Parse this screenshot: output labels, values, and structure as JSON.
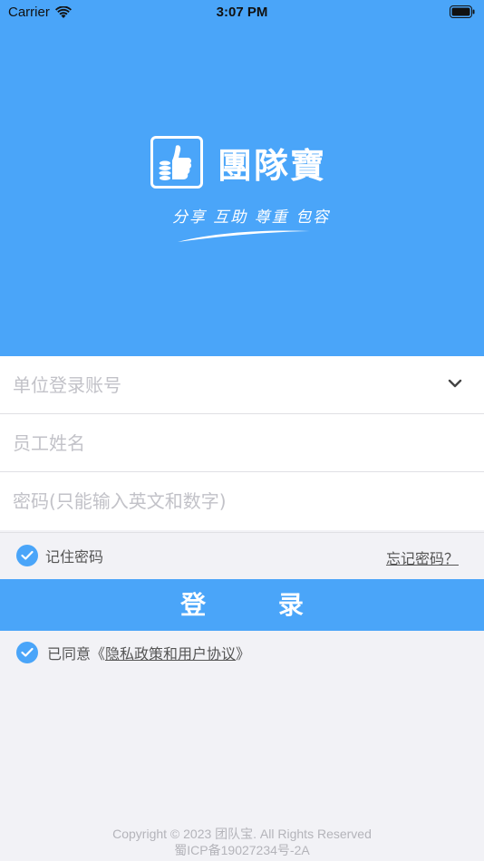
{
  "status_bar": {
    "carrier": "Carrier",
    "time": "3:07 PM"
  },
  "brand": {
    "name": "團隊寶",
    "slogan": "分享 互助 尊重 包容",
    "color": "#4aa5f9"
  },
  "form": {
    "account_placeholder": "单位登录账号",
    "name_placeholder": "员工姓名",
    "password_placeholder": "密码(只能输入英文和数字)"
  },
  "options": {
    "remember_label": "记住密码",
    "remember_checked": true,
    "forgot_label": "忘记密码？"
  },
  "login_label": "登 录",
  "agreement": {
    "checked": true,
    "prefix": "已同意",
    "open": "《",
    "link": "隐私政策和用户协议",
    "close": "》"
  },
  "footer": {
    "copyright": "Copyright © 2023 团队宝. All Rights Reserved",
    "icp": "蜀ICP备19027234号-2A"
  }
}
